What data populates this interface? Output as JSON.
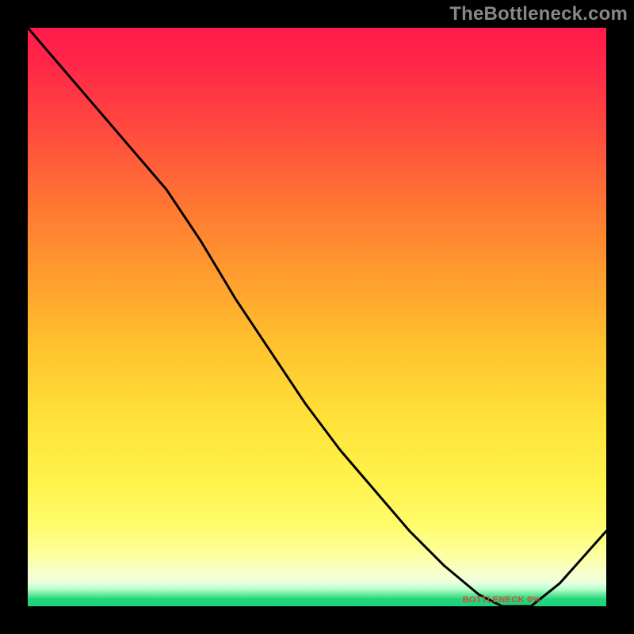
{
  "watermark": {
    "text": "TheBottleneck.com"
  },
  "chart_data": {
    "type": "line",
    "title": "",
    "xlabel": "",
    "ylabel": "",
    "xlim": [
      0,
      1
    ],
    "ylim": [
      0,
      1
    ],
    "x": [
      0.0,
      0.06,
      0.12,
      0.18,
      0.24,
      0.3,
      0.36,
      0.42,
      0.48,
      0.54,
      0.6,
      0.66,
      0.72,
      0.78,
      0.82,
      0.87,
      0.92,
      1.0
    ],
    "y": [
      1.0,
      0.93,
      0.86,
      0.79,
      0.72,
      0.63,
      0.53,
      0.44,
      0.35,
      0.27,
      0.2,
      0.13,
      0.07,
      0.02,
      0.0,
      0.0,
      0.04,
      0.13
    ],
    "annotations": [
      {
        "text": "BOTTLENECK 0%",
        "x": 0.82,
        "y": 0.005
      }
    ],
    "background_gradient": {
      "stops": [
        {
          "pos": 0.0,
          "color": "#ff1a4b"
        },
        {
          "pos": 0.4,
          "color": "#ff9a2f"
        },
        {
          "pos": 0.78,
          "color": "#fff24a"
        },
        {
          "pos": 0.95,
          "color": "#f6ffcf"
        },
        {
          "pos": 1.0,
          "color": "#1fd47b"
        }
      ]
    }
  }
}
